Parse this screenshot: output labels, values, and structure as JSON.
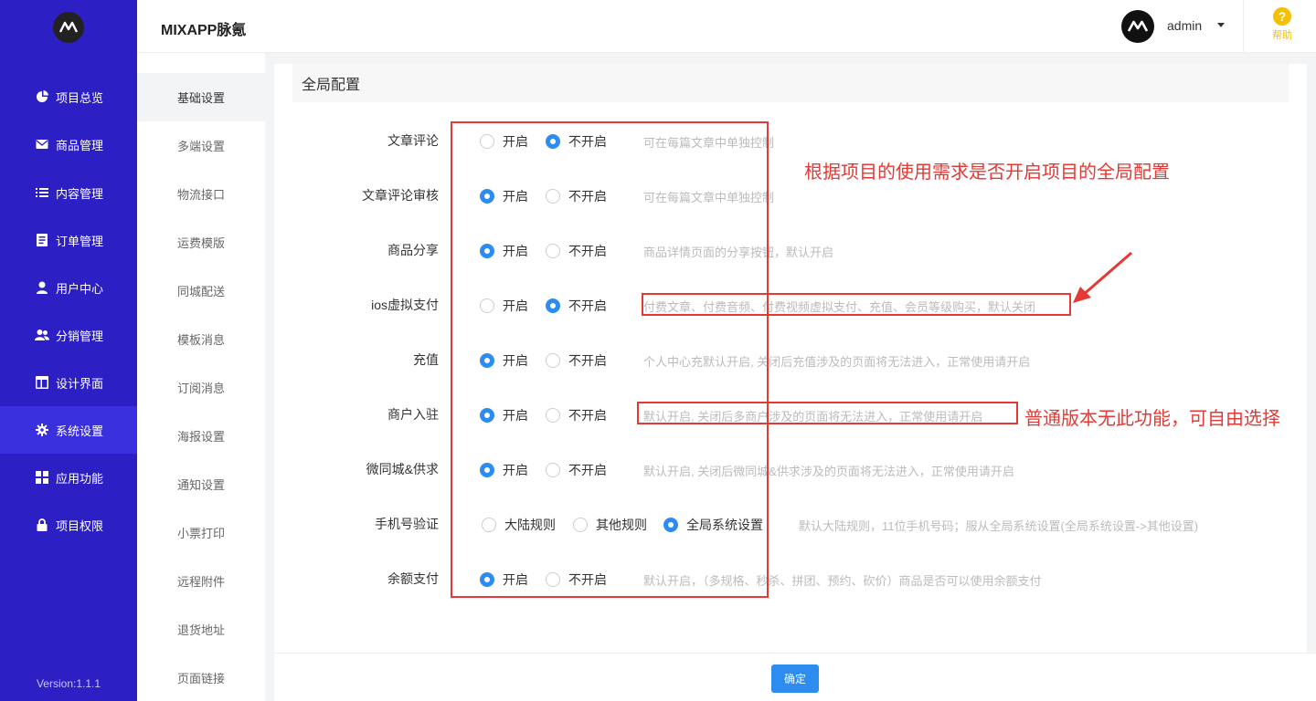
{
  "header": {
    "app_title": "MIXAPP脉氪",
    "user_name": "admin",
    "help_label": "帮助"
  },
  "sidebar": {
    "items": [
      {
        "label": "项目总览",
        "icon": "pie-chart-icon"
      },
      {
        "label": "商品管理",
        "icon": "envelope-icon"
      },
      {
        "label": "内容管理",
        "icon": "list-icon"
      },
      {
        "label": "订单管理",
        "icon": "document-icon"
      },
      {
        "label": "用户中心",
        "icon": "user-icon"
      },
      {
        "label": "分销管理",
        "icon": "users-icon"
      },
      {
        "label": "设计界面",
        "icon": "layout-icon"
      },
      {
        "label": "系统设置",
        "icon": "gear-icon",
        "active": true
      },
      {
        "label": "应用功能",
        "icon": "grid-icon"
      },
      {
        "label": "项目权限",
        "icon": "lock-icon"
      }
    ],
    "version": "Version:1.1.1"
  },
  "submenu": {
    "items": [
      "基础设置",
      "多端设置",
      "物流接口",
      "运费模版",
      "同城配送",
      "模板消息",
      "订阅消息",
      "海报设置",
      "通知设置",
      "小票打印",
      "远程附件",
      "退货地址",
      "页面链接"
    ],
    "active_index": 0
  },
  "main": {
    "section_title": "全局配置",
    "rows": [
      {
        "label": "文章评论",
        "options": [
          "开启",
          "不开启"
        ],
        "selected": 1,
        "hint": "可在每篇文章中单独控制"
      },
      {
        "label": "文章评论审核",
        "options": [
          "开启",
          "不开启"
        ],
        "selected": 0,
        "hint": "可在每篇文章中单独控制"
      },
      {
        "label": "商品分享",
        "options": [
          "开启",
          "不开启"
        ],
        "selected": 0,
        "hint": "商品详情页面的分享按钮，默认开启"
      },
      {
        "label": "ios虚拟支付",
        "options": [
          "开启",
          "不开启"
        ],
        "selected": 1,
        "hint": "付费文章、付费音频、付费视频虚拟支付、充值、会员等级购买，默认关闭"
      },
      {
        "label": "充值",
        "options": [
          "开启",
          "不开启"
        ],
        "selected": 0,
        "hint": "个人中心充默认开启, 关闭后充值涉及的页面将无法进入，正常使用请开启"
      },
      {
        "label": "商户入驻",
        "options": [
          "开启",
          "不开启"
        ],
        "selected": 0,
        "hint": "默认开启, 关闭后多商户涉及的页面将无法进入，正常使用请开启"
      },
      {
        "label": "微同城&供求",
        "options": [
          "开启",
          "不开启"
        ],
        "selected": 0,
        "hint": "默认开启, 关闭后微同城&供求涉及的页面将无法进入，正常使用请开启"
      },
      {
        "label": "手机号验证",
        "options": [
          "大陆规则",
          "其他规则",
          "全局系统设置"
        ],
        "selected": 2,
        "hint": "默认大陆规则，11位手机号码；服从全局系统设置(全局系统设置->其他设置)"
      },
      {
        "label": "余额支付",
        "options": [
          "开启",
          "不开启"
        ],
        "selected": 0,
        "hint": "默认开启，（多规格、秒杀、拼团、预约、砍价）商品是否可以使用余额支付"
      }
    ],
    "confirm_label": "确定"
  },
  "annotations": {
    "note_global": "根据项目的使用需求是否开启项目的全局配置",
    "note_merchant": "普通版本无此功能，可自由选择"
  },
  "colors": {
    "sidebar_bg": "#2c1fc4",
    "sidebar_active": "#3b30dd",
    "accent": "#2d8cf0",
    "annotation": "#e53935",
    "help": "#f5c000"
  }
}
